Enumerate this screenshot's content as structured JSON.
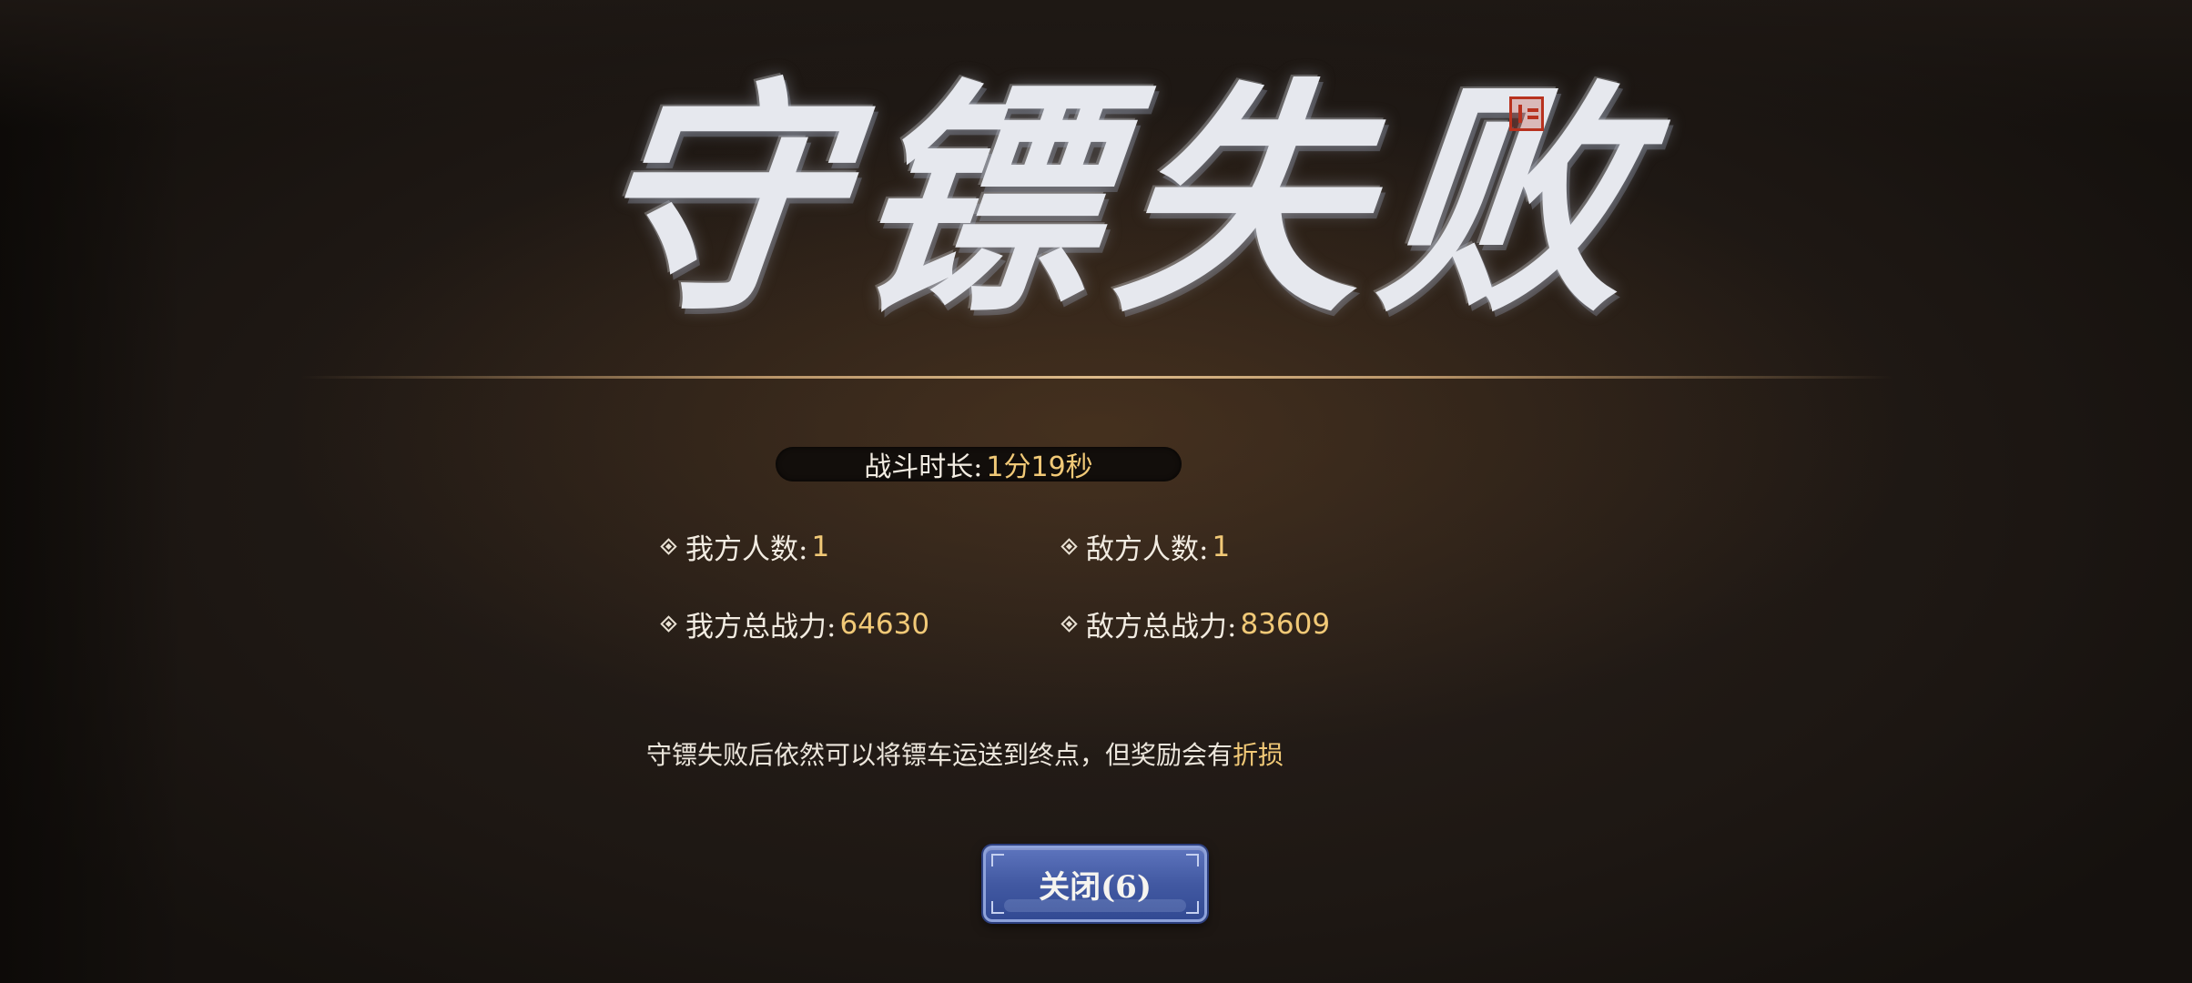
{
  "title": "守镖失败",
  "duration": {
    "label": "战斗时长:",
    "value": "1分19秒"
  },
  "stats": {
    "ally_count": {
      "label": "我方人数:",
      "value": "1"
    },
    "enemy_count": {
      "label": "敌方人数:",
      "value": "1"
    },
    "ally_power": {
      "label": "我方总战力:",
      "value": "64630"
    },
    "enemy_power": {
      "label": "敌方总战力:",
      "value": "83609"
    }
  },
  "notice": {
    "text": "守镖失败后依然可以将镖车运送到终点，但奖励会有",
    "highlight": "折损"
  },
  "close_button": {
    "label": "关闭(6)"
  },
  "colors": {
    "accent_gold": "#f1c977",
    "button_blue": "#4259a2",
    "seal_red": "#b8321f"
  }
}
